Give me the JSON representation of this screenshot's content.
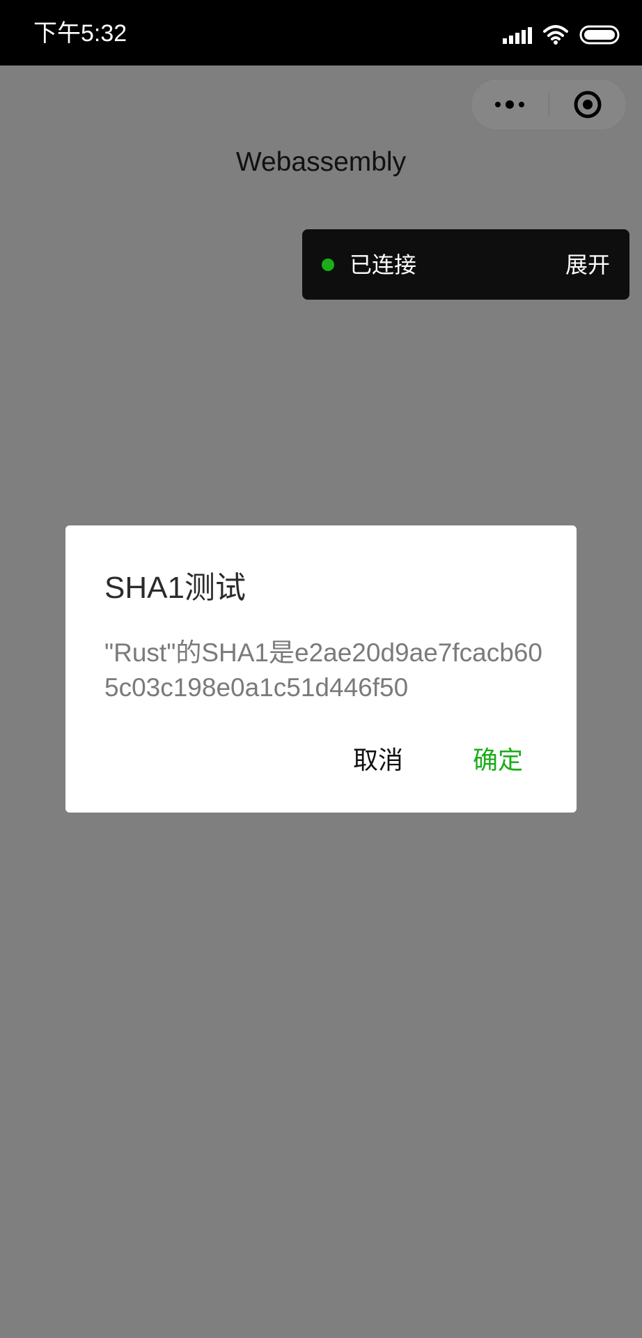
{
  "status_bar": {
    "time": "下午5:32",
    "icons": [
      "signal-icon",
      "wifi-icon",
      "battery-icon"
    ]
  },
  "capsule": {
    "more_icon": "more-dots-icon",
    "close_icon": "target-close-icon"
  },
  "page": {
    "title": "Webassembly"
  },
  "vconsole": {
    "status": "已连接",
    "expand_label": "展开",
    "status_color": "#1aad19"
  },
  "dialog": {
    "title": "SHA1测试",
    "content": "\"Rust\"的SHA1是e2ae20d9ae7fcacb605c03c198e0a1c51d446f50",
    "cancel_label": "取消",
    "confirm_label": "确定",
    "confirm_color": "#1aad19"
  },
  "colors": {
    "mask": "#7f7f7f",
    "status_bar": "#000000"
  }
}
